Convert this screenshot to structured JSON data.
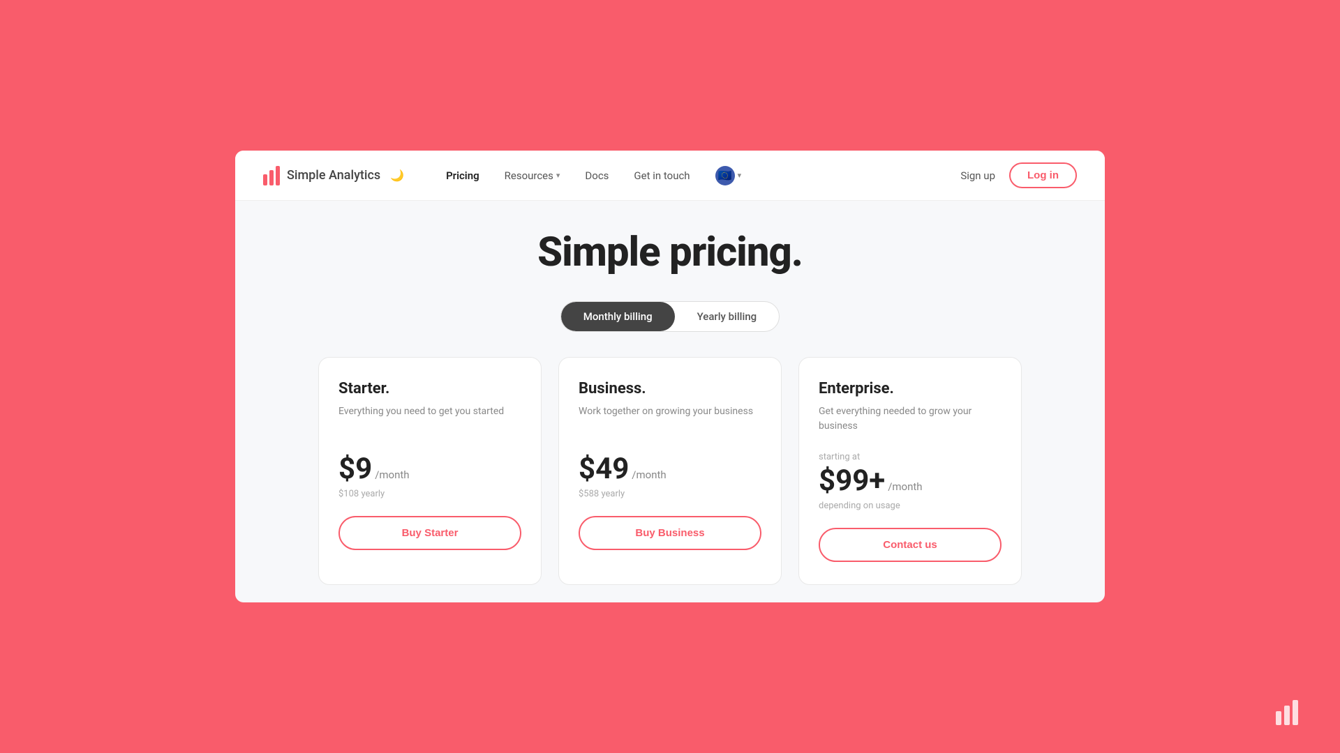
{
  "logo": {
    "text": "Simple Analytics",
    "moon": "🌙"
  },
  "nav": {
    "links": [
      {
        "id": "pricing",
        "label": "Pricing",
        "hasChevron": false,
        "active": true
      },
      {
        "id": "resources",
        "label": "Resources",
        "hasChevron": true,
        "active": false
      },
      {
        "id": "docs",
        "label": "Docs",
        "hasChevron": false,
        "active": false
      },
      {
        "id": "get-in-touch",
        "label": "Get in touch",
        "hasChevron": false,
        "active": false
      }
    ],
    "eu_flag": "🇪🇺",
    "signup_label": "Sign up",
    "login_label": "Log in"
  },
  "hero": {
    "title": "Simple pricing."
  },
  "billing": {
    "monthly_label": "Monthly billing",
    "yearly_label": "Yearly billing",
    "active": "monthly"
  },
  "plans": [
    {
      "id": "starter",
      "name": "Starter.",
      "description": "Everything you need to get you started",
      "starting_at": "",
      "price": "$9",
      "period": "/month",
      "yearly": "$108 yearly",
      "usage": "",
      "button_label": "Buy Starter"
    },
    {
      "id": "business",
      "name": "Business.",
      "description": "Work together on growing your business",
      "starting_at": "",
      "price": "$49",
      "period": "/month",
      "yearly": "$588 yearly",
      "usage": "",
      "button_label": "Buy Business"
    },
    {
      "id": "enterprise",
      "name": "Enterprise.",
      "description": "Get everything needed to grow your business",
      "starting_at": "starting at",
      "price": "$99+",
      "period": "/month",
      "yearly": "",
      "usage": "depending on usage",
      "button_label": "Contact us"
    }
  ]
}
